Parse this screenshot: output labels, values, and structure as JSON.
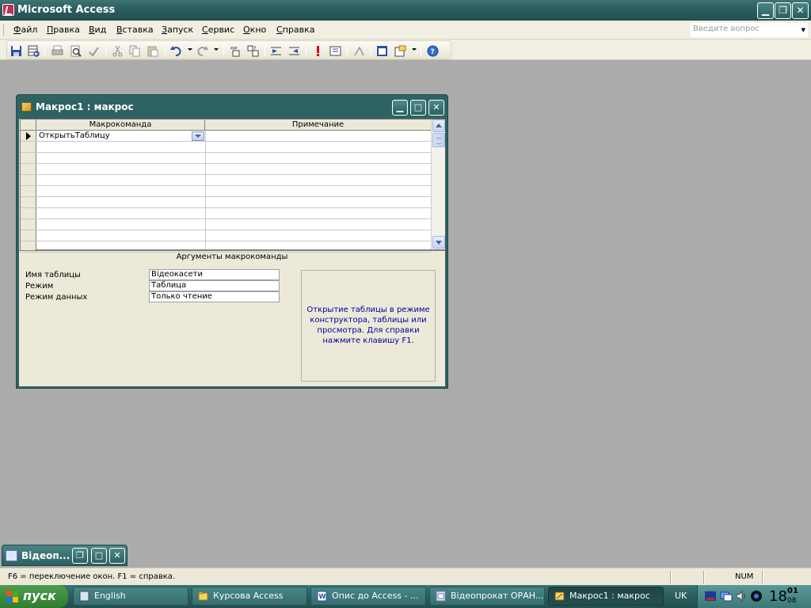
{
  "app": {
    "title": "Microsoft Access"
  },
  "menu": {
    "items": [
      "Файл",
      "Правка",
      "Вид",
      "Вставка",
      "Запуск",
      "Сервис",
      "Окно",
      "Справка"
    ],
    "help_placeholder": "Введите вопрос"
  },
  "toolbar": {
    "buttons": [
      "save-icon",
      "table-view-icon",
      "print-icon",
      "print-preview-icon",
      "spelling-icon",
      "cut-icon",
      "copy-icon",
      "paste-icon",
      "undo-icon",
      "redo-icon",
      "macro-names-icon",
      "conditions-icon",
      "insert-rows-icon",
      "delete-rows-icon",
      "run-icon",
      "step-icon",
      "build-icon",
      "database-window-icon",
      "new-object-icon",
      "help-icon"
    ]
  },
  "macro_window": {
    "title": "Макрос1 : макрос",
    "columns": {
      "action": "Макрокоманда",
      "comment": "Примечание"
    },
    "rows": [
      {
        "action": "ОткрытьТаблицу",
        "comment": ""
      }
    ],
    "arguments_title": "Аргументы макрокоманды",
    "arguments": [
      {
        "label": "Имя таблицы",
        "value": "Відеокасети"
      },
      {
        "label": "Режим",
        "value": "Таблица"
      },
      {
        "label": "Режим данных",
        "value": "Только чтение"
      }
    ],
    "help_text": "Открытие таблицы в режиме конструктора, таблицы или просмотра. Для справки нажмите клавишу F1."
  },
  "minimized_window": {
    "title": "Відеоп..."
  },
  "statusbar": {
    "text": "F6 = переключение окон.  F1 = справка.",
    "num": "NUM"
  },
  "taskbar": {
    "start_label": "пуск",
    "tasks": [
      {
        "label": "English",
        "icon": "language-icon",
        "active": false
      },
      {
        "label": "Курсова Access",
        "icon": "folder-icon",
        "active": false
      },
      {
        "label": "Опис до Access - ...",
        "icon": "word-document-icon",
        "active": false
      },
      {
        "label": "Відеопрокат ОРАН...",
        "icon": "database-icon",
        "active": false
      },
      {
        "label": "Макрос1 : макрос",
        "icon": "macro-icon",
        "active": true
      }
    ],
    "language": "UK",
    "clock": {
      "hour": "18",
      "minute": "01",
      "second": "08"
    }
  },
  "colors": {
    "title_bar": "#2d5f5f",
    "workspace": "#ababab",
    "help_text": "#0000a0"
  }
}
